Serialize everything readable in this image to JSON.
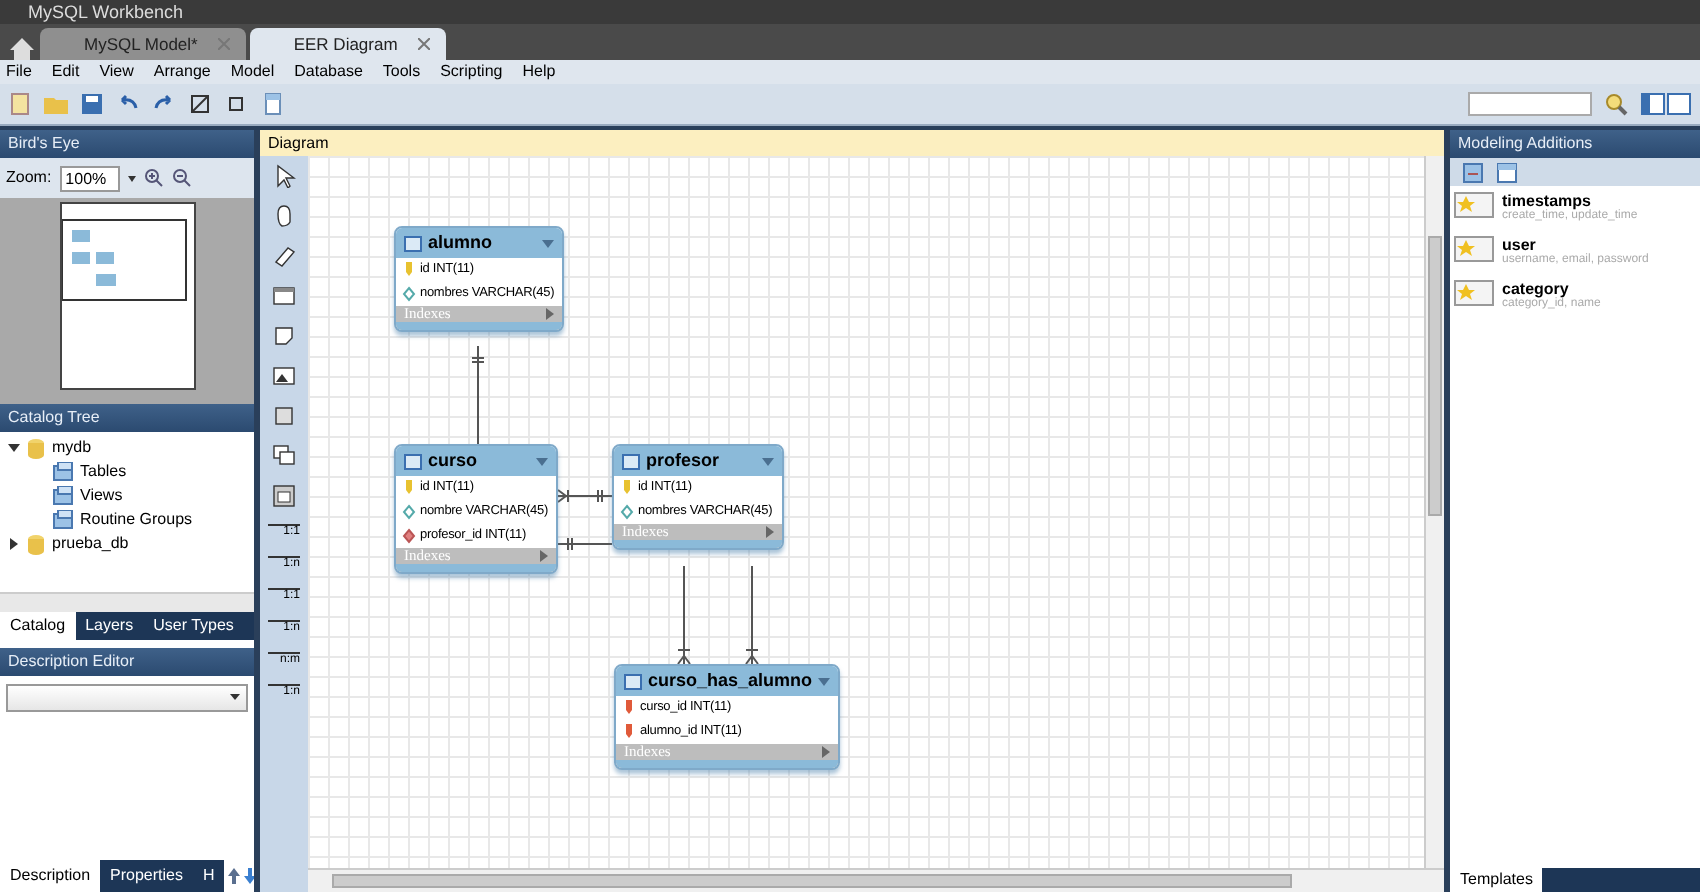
{
  "window": {
    "title": "MySQL Workbench"
  },
  "tabs": [
    {
      "label": "MySQL Model*",
      "selected": false
    },
    {
      "label": "EER Diagram",
      "selected": true
    }
  ],
  "menu": [
    "File",
    "Edit",
    "View",
    "Arrange",
    "Model",
    "Database",
    "Tools",
    "Scripting",
    "Help"
  ],
  "birds_eye": {
    "title": "Bird's Eye",
    "zoom_label": "Zoom:",
    "zoom_value": "100%"
  },
  "catalog_tree": {
    "title": "Catalog Tree",
    "items": [
      {
        "label": "mydb",
        "expanded": true,
        "children": [
          {
            "label": "Tables"
          },
          {
            "label": "Views"
          },
          {
            "label": "Routine Groups"
          }
        ]
      },
      {
        "label": "prueba_db",
        "expanded": false
      }
    ]
  },
  "left_tabs": [
    {
      "label": "Catalog",
      "selected": true
    },
    {
      "label": "Layers",
      "selected": false
    },
    {
      "label": "User Types",
      "selected": false
    }
  ],
  "description_editor": {
    "title": "Description Editor"
  },
  "bottom_tabs": [
    {
      "label": "Description",
      "selected": true
    },
    {
      "label": "Properties",
      "selected": false
    },
    {
      "label": "H",
      "selected": false
    }
  ],
  "diagram": {
    "title": "Diagram",
    "relationship_tools": [
      "1:1",
      "1:n",
      "1:1",
      "1:n",
      "n:m",
      "1:n"
    ],
    "tables": [
      {
        "name": "alumno",
        "indexes_label": "Indexes",
        "columns": [
          {
            "text": "id INT(11)",
            "kind": "pk"
          },
          {
            "text": "nombres VARCHAR(45)",
            "kind": "attr"
          }
        ]
      },
      {
        "name": "curso",
        "indexes_label": "Indexes",
        "columns": [
          {
            "text": "id INT(11)",
            "kind": "pk"
          },
          {
            "text": "nombre VARCHAR(45)",
            "kind": "attr"
          },
          {
            "text": "profesor_id INT(11)",
            "kind": "fk"
          }
        ]
      },
      {
        "name": "profesor",
        "indexes_label": "Indexes",
        "columns": [
          {
            "text": "id INT(11)",
            "kind": "pk"
          },
          {
            "text": "nombres VARCHAR(45)",
            "kind": "attr"
          }
        ]
      },
      {
        "name": "curso_has_alumno",
        "indexes_label": "Indexes",
        "columns": [
          {
            "text": "curso_id INT(11)",
            "kind": "pkfk"
          },
          {
            "text": "alumno_id INT(11)",
            "kind": "pkfk"
          }
        ]
      }
    ]
  },
  "modeling_additions": {
    "title": "Modeling Additions",
    "items": [
      {
        "name": "timestamps",
        "fields": "create_time, update_time"
      },
      {
        "name": "user",
        "fields": "username, email, password"
      },
      {
        "name": "category",
        "fields": "category_id, name"
      }
    ]
  },
  "right_tabs": [
    {
      "label": "Templates",
      "selected": true
    }
  ]
}
